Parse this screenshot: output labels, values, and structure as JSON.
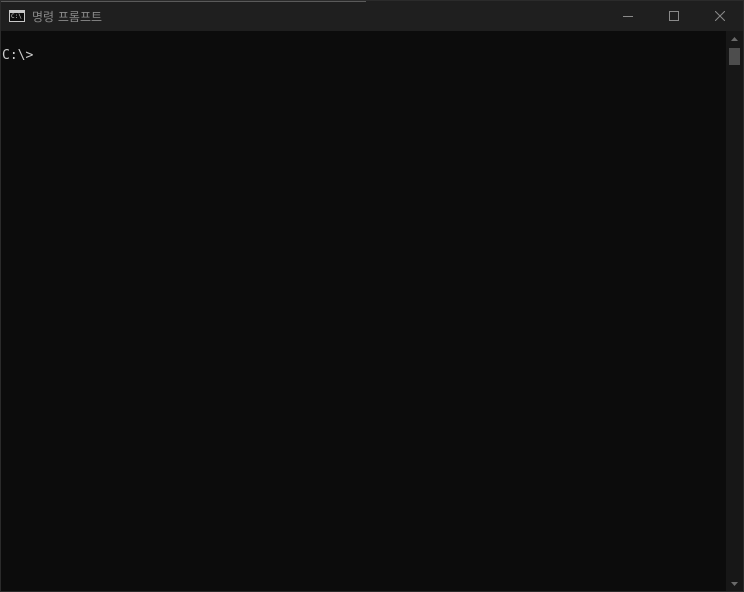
{
  "window": {
    "title": "명령 프롬프트",
    "icon": "cmd-icon",
    "icon_text": "C:\\",
    "controls": {
      "minimize": "minimize-icon",
      "maximize": "maximize-icon",
      "close": "close-icon"
    }
  },
  "console": {
    "prompt": "C:\\>"
  },
  "colors": {
    "background": "#0c0c0c",
    "titlebar": "#1f1f1f",
    "text": "#cccccc",
    "scroll_thumb": "#4d4d4d"
  }
}
